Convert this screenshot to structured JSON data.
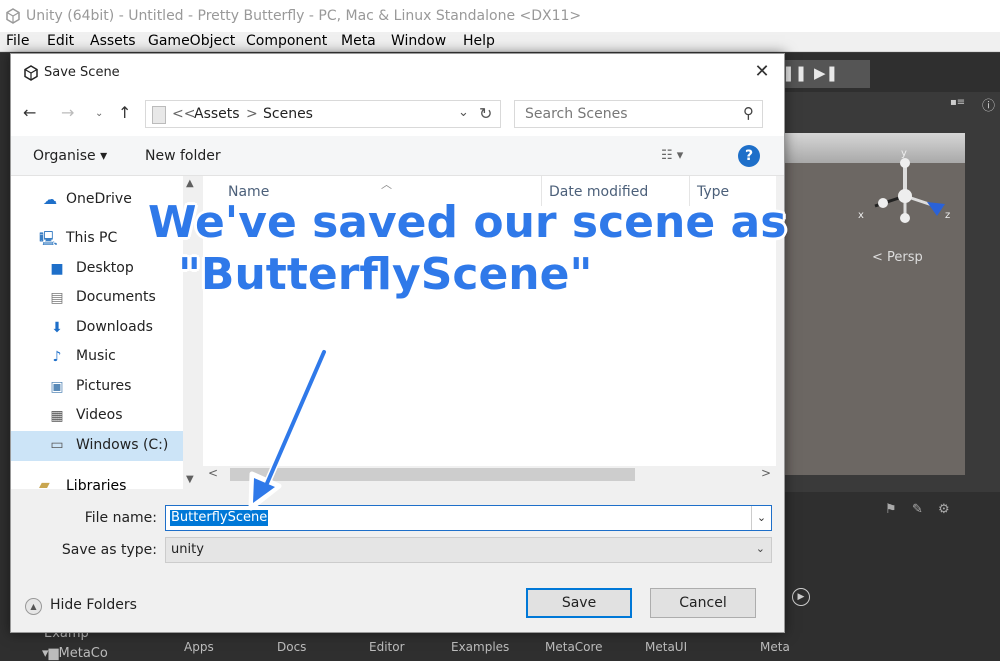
{
  "window": {
    "title": "Unity (64bit) - Untitled - Pretty Butterfly - PC, Mac & Linux Standalone <DX11>",
    "menu": [
      "File",
      "Edit",
      "Assets",
      "GameObject",
      "Component",
      "Meta",
      "Window",
      "Help"
    ]
  },
  "unity": {
    "scene_label": "Persp",
    "gizmo_axes": {
      "x": "x",
      "y": "y",
      "z": "z"
    },
    "bottom_tabs": [
      "Apps",
      "Docs",
      "Editor",
      "Examples",
      "MetaCore",
      "MetaUI",
      "Meta"
    ],
    "project_tree": [
      "Examp",
      "MetaCo"
    ]
  },
  "dialog": {
    "title": "Save Scene",
    "breadcrumb": [
      "<<",
      "Assets",
      ">",
      "Scenes"
    ],
    "search_placeholder": "Search Scenes",
    "toolbar": {
      "organise": "Organise",
      "new_folder": "New folder"
    },
    "nav_items": [
      {
        "label": "OneDrive",
        "icon": "cloud-icon"
      },
      {
        "label": "This PC",
        "icon": "computer-icon"
      },
      {
        "label": "Desktop",
        "icon": "desktop-icon"
      },
      {
        "label": "Documents",
        "icon": "documents-icon"
      },
      {
        "label": "Downloads",
        "icon": "download-icon"
      },
      {
        "label": "Music",
        "icon": "music-icon"
      },
      {
        "label": "Pictures",
        "icon": "pictures-icon"
      },
      {
        "label": "Videos",
        "icon": "videos-icon"
      },
      {
        "label": "Windows (C:)",
        "icon": "drive-icon",
        "selected": true
      },
      {
        "label": "Libraries",
        "icon": "libraries-icon"
      }
    ],
    "columns": [
      "Name",
      "Date modified",
      "Type"
    ],
    "file_name_label": "File name:",
    "file_name_value": "ButterflyScene",
    "save_type_label": "Save as type:",
    "save_type_value": "unity",
    "hide_folders": "Hide Folders",
    "save_button": "Save",
    "cancel_button": "Cancel"
  },
  "annotation": {
    "line1": "We've saved our scene as",
    "line2": "\"ButterflyScene\"",
    "color": "#2f79e9"
  }
}
